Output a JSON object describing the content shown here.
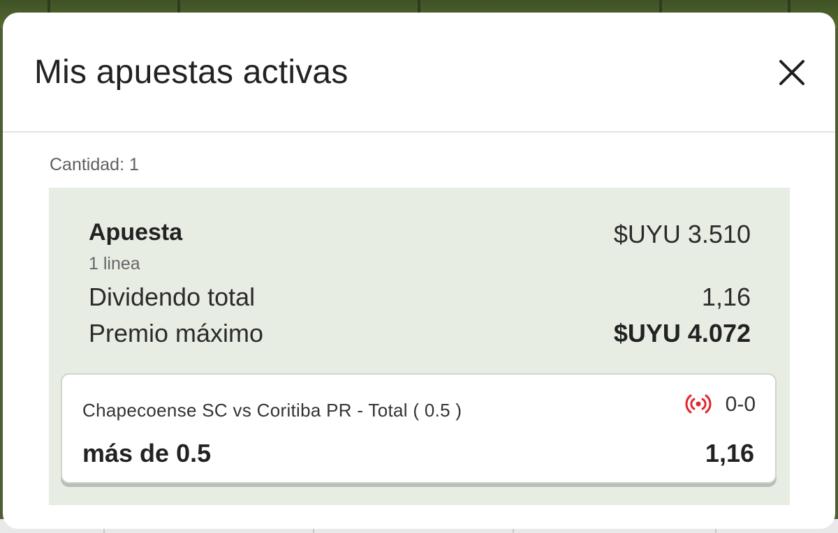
{
  "modal": {
    "title": "Mis apuestas activas",
    "count_label": "Cantidad: 1"
  },
  "bet": {
    "title": "Apuesta",
    "lines": "1 linea",
    "amount": "$UYU 3.510",
    "dividend_label": "Dividendo total",
    "dividend_value": "1,16",
    "prize_label": "Premio máximo",
    "prize_value": "$UYU 4.072"
  },
  "selection": {
    "event": "Chapecoense SC vs Coritiba PR - Total ( 0.5 )",
    "score": "0-0",
    "pick": "más de 0.5",
    "odds": "1,16",
    "live_icon": "live-broadcast-icon",
    "live_color": "#e3262e"
  },
  "colors": {
    "panel_bg": "#e8ede4",
    "modal_bg": "#ffffff",
    "text": "#2b2b2b"
  }
}
